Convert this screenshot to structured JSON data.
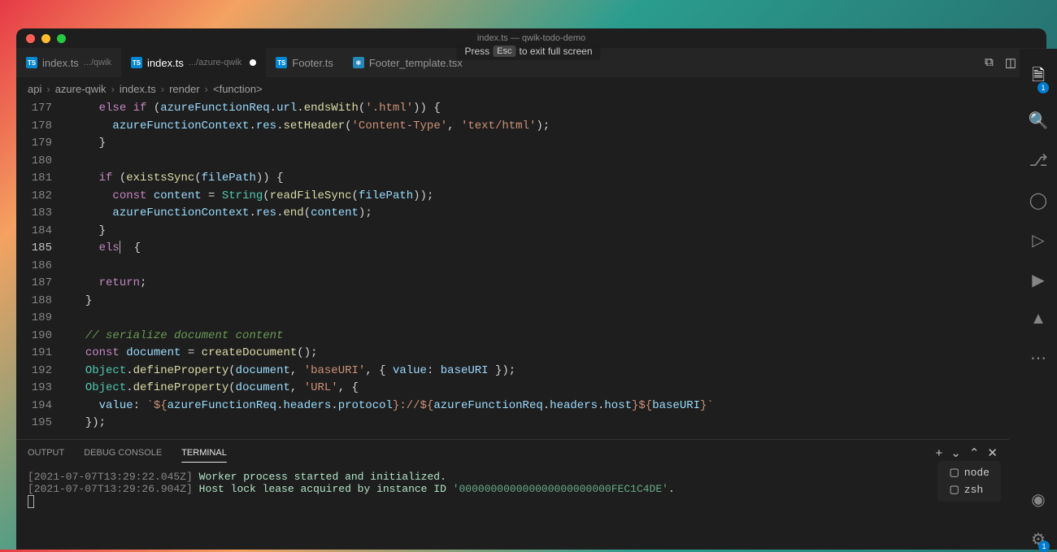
{
  "window_title": "index.ts — qwik-todo-demo",
  "hint": {
    "pre": "Press",
    "key": "Esc",
    "post": "to exit full screen"
  },
  "tabs": [
    {
      "name": "index.ts",
      "sub": ".../qwik",
      "icon": "TS"
    },
    {
      "name": "index.ts",
      "sub": ".../azure-qwik",
      "icon": "TS",
      "active": true,
      "modified": true
    },
    {
      "name": "Footer.ts",
      "icon": "TS"
    },
    {
      "name": "Footer_template.tsx",
      "icon": "react"
    }
  ],
  "breadcrumbs": [
    "api",
    "azure-qwik",
    "index.ts",
    "render",
    "<function>"
  ],
  "line_start": 177,
  "current_line": 185,
  "code": [
    {
      "i": "    ",
      "t": [
        [
          "k",
          "else if"
        ],
        [
          "p",
          " ("
        ],
        [
          "v",
          "azureFunctionReq"
        ],
        [
          "p",
          "."
        ],
        [
          "v",
          "url"
        ],
        [
          "p",
          "."
        ],
        [
          "f",
          "endsWith"
        ],
        [
          "p",
          "("
        ],
        [
          "s",
          "'.html'"
        ],
        [
          "p",
          ")) {"
        ]
      ]
    },
    {
      "i": "      ",
      "t": [
        [
          "v",
          "azureFunctionContext"
        ],
        [
          "p",
          "."
        ],
        [
          "v",
          "res"
        ],
        [
          "p",
          "."
        ],
        [
          "f",
          "setHeader"
        ],
        [
          "p",
          "("
        ],
        [
          "s",
          "'Content-Type'"
        ],
        [
          "p",
          ", "
        ],
        [
          "s",
          "'text/html'"
        ],
        [
          "p",
          ");"
        ]
      ]
    },
    {
      "i": "    ",
      "t": [
        [
          "p",
          "}"
        ]
      ]
    },
    {
      "i": "",
      "t": []
    },
    {
      "i": "    ",
      "t": [
        [
          "k",
          "if"
        ],
        [
          "p",
          " ("
        ],
        [
          "f",
          "existsSync"
        ],
        [
          "p",
          "("
        ],
        [
          "v",
          "filePath"
        ],
        [
          "p",
          ")) {"
        ]
      ]
    },
    {
      "i": "      ",
      "t": [
        [
          "k",
          "const"
        ],
        [
          "p",
          " "
        ],
        [
          "v",
          "content"
        ],
        [
          "p",
          " = "
        ],
        [
          "t",
          "String"
        ],
        [
          "p",
          "("
        ],
        [
          "f",
          "readFileSync"
        ],
        [
          "p",
          "("
        ],
        [
          "v",
          "filePath"
        ],
        [
          "p",
          "));"
        ]
      ]
    },
    {
      "i": "      ",
      "t": [
        [
          "v",
          "azureFunctionContext"
        ],
        [
          "p",
          "."
        ],
        [
          "v",
          "res"
        ],
        [
          "p",
          "."
        ],
        [
          "f",
          "end"
        ],
        [
          "p",
          "("
        ],
        [
          "v",
          "content"
        ],
        [
          "p",
          ");"
        ]
      ]
    },
    {
      "i": "    ",
      "t": [
        [
          "p",
          "}"
        ]
      ]
    },
    {
      "i": "    ",
      "t": [
        [
          "k",
          "els"
        ],
        [
          "cur",
          ""
        ],
        [
          "p",
          "  {"
        ]
      ]
    },
    {
      "i": "",
      "t": []
    },
    {
      "i": "    ",
      "t": [
        [
          "k",
          "return"
        ],
        [
          "p",
          ";"
        ]
      ]
    },
    {
      "i": "  ",
      "t": [
        [
          "p",
          "}"
        ]
      ]
    },
    {
      "i": "",
      "t": []
    },
    {
      "i": "  ",
      "t": [
        [
          "c",
          "// serialize document content"
        ]
      ]
    },
    {
      "i": "  ",
      "t": [
        [
          "k",
          "const"
        ],
        [
          "p",
          " "
        ],
        [
          "v",
          "document"
        ],
        [
          "p",
          " = "
        ],
        [
          "f",
          "createDocument"
        ],
        [
          "p",
          "();"
        ]
      ]
    },
    {
      "i": "  ",
      "t": [
        [
          "t",
          "Object"
        ],
        [
          "p",
          "."
        ],
        [
          "f",
          "defineProperty"
        ],
        [
          "p",
          "("
        ],
        [
          "v",
          "document"
        ],
        [
          "p",
          ", "
        ],
        [
          "s",
          "'baseURI'"
        ],
        [
          "p",
          ", { "
        ],
        [
          "v",
          "value"
        ],
        [
          "p",
          ": "
        ],
        [
          "v",
          "baseURI"
        ],
        [
          "p",
          " });"
        ]
      ]
    },
    {
      "i": "  ",
      "t": [
        [
          "t",
          "Object"
        ],
        [
          "p",
          "."
        ],
        [
          "f",
          "defineProperty"
        ],
        [
          "p",
          "("
        ],
        [
          "v",
          "document"
        ],
        [
          "p",
          ", "
        ],
        [
          "s",
          "'URL'"
        ],
        [
          "p",
          ", {"
        ]
      ]
    },
    {
      "i": "    ",
      "t": [
        [
          "v",
          "value"
        ],
        [
          "p",
          ": "
        ],
        [
          "s",
          "`${"
        ],
        [
          "v",
          "azureFunctionReq"
        ],
        [
          "p",
          "."
        ],
        [
          "v",
          "headers"
        ],
        [
          "p",
          "."
        ],
        [
          "v",
          "protocol"
        ],
        [
          "s",
          "}://${"
        ],
        [
          "v",
          "azureFunctionReq"
        ],
        [
          "p",
          "."
        ],
        [
          "v",
          "headers"
        ],
        [
          "p",
          "."
        ],
        [
          "v",
          "host"
        ],
        [
          "s",
          "}${"
        ],
        [
          "v",
          "baseURI"
        ],
        [
          "s",
          "}`"
        ]
      ]
    },
    {
      "i": "  ",
      "t": [
        [
          "p",
          "});"
        ]
      ]
    }
  ],
  "panel": {
    "tabs": [
      "OUTPUT",
      "DEBUG CONSOLE",
      "TERMINAL"
    ],
    "active": 2,
    "procs": [
      "node",
      "zsh"
    ],
    "lines": [
      {
        "ts": "[2021-07-07T13:29:22.045Z]",
        "msg": "Worker process started and initialized."
      },
      {
        "ts": "[2021-07-07T13:29:26.904Z]",
        "msg": "Host lock lease acquired by instance ID ",
        "id": "'000000000000000000000000FEC1C4DE'",
        "tail": "."
      }
    ]
  },
  "badges": {
    "explorer": "1",
    "settings": "1"
  }
}
